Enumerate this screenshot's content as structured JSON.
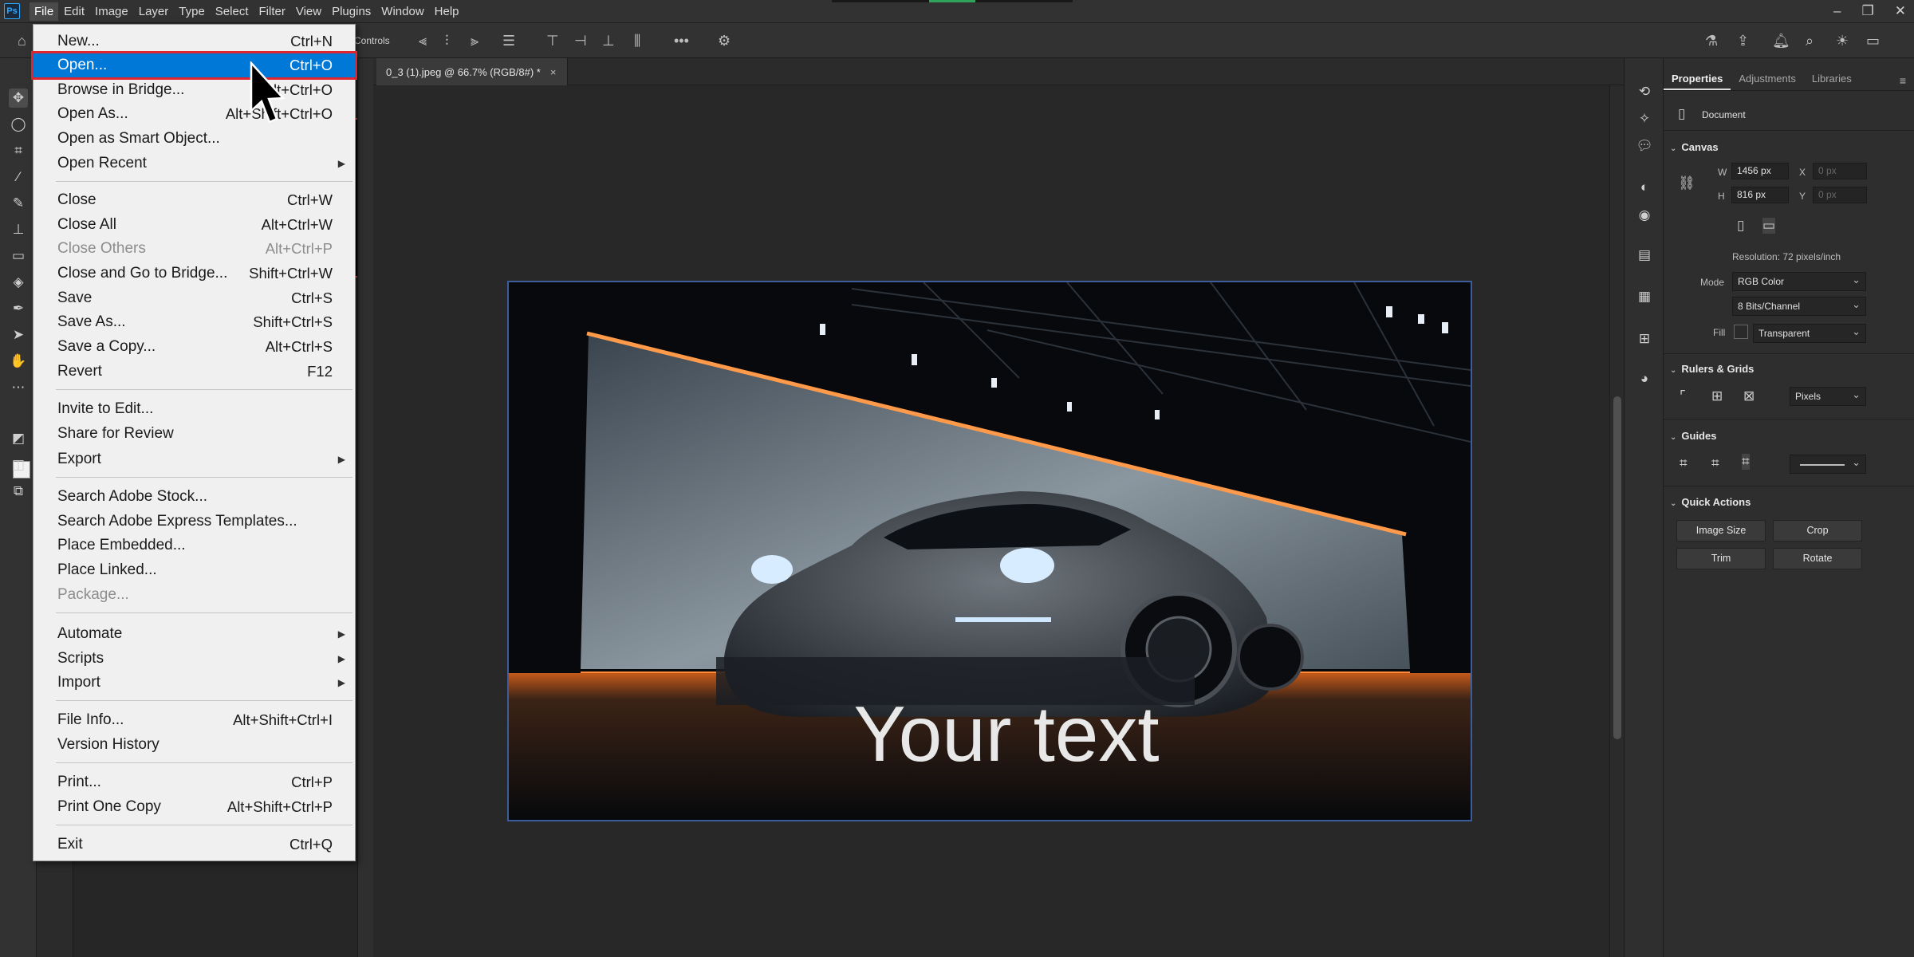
{
  "menubar": {
    "items": [
      "File",
      "Edit",
      "Image",
      "Layer",
      "Type",
      "Select",
      "Filter",
      "View",
      "Plugins",
      "Window",
      "Help"
    ]
  },
  "options": {
    "controls_label": "Controls"
  },
  "document": {
    "tab_title": "0_3 (1).jpeg @ 66.7% (RGB/8#) *",
    "overlay_text": "Your text"
  },
  "file_menu": {
    "items": [
      {
        "label": "New...",
        "shortcut": "Ctrl+N"
      },
      {
        "label": "Open...",
        "shortcut": "Ctrl+O"
      },
      {
        "label": "Browse in Bridge...",
        "shortcut": "Alt+Ctrl+O"
      },
      {
        "label": "Open As...",
        "shortcut": "Alt+Shift+Ctrl+O"
      },
      {
        "label": "Open as Smart Object...",
        "shortcut": ""
      },
      {
        "label": "Open Recent",
        "shortcut": ""
      },
      {
        "label": "Close",
        "shortcut": "Ctrl+W"
      },
      {
        "label": "Close All",
        "shortcut": "Alt+Ctrl+W"
      },
      {
        "label": "Close Others",
        "shortcut": "Alt+Ctrl+P"
      },
      {
        "label": "Close and Go to Bridge...",
        "shortcut": "Shift+Ctrl+W"
      },
      {
        "label": "Save",
        "shortcut": "Ctrl+S"
      },
      {
        "label": "Save As...",
        "shortcut": "Shift+Ctrl+S"
      },
      {
        "label": "Save a Copy...",
        "shortcut": "Alt+Ctrl+S"
      },
      {
        "label": "Revert",
        "shortcut": "F12"
      },
      {
        "label": "Invite to Edit...",
        "shortcut": ""
      },
      {
        "label": "Share for Review",
        "shortcut": ""
      },
      {
        "label": "Export",
        "shortcut": ""
      },
      {
        "label": "Search Adobe Stock...",
        "shortcut": ""
      },
      {
        "label": "Search Adobe Express Templates...",
        "shortcut": ""
      },
      {
        "label": "Place Embedded...",
        "shortcut": ""
      },
      {
        "label": "Place Linked...",
        "shortcut": ""
      },
      {
        "label": "Package...",
        "shortcut": ""
      },
      {
        "label": "Automate",
        "shortcut": ""
      },
      {
        "label": "Scripts",
        "shortcut": ""
      },
      {
        "label": "Import",
        "shortcut": ""
      },
      {
        "label": "File Info...",
        "shortcut": "Alt+Shift+Ctrl+I"
      },
      {
        "label": "Version History",
        "shortcut": ""
      },
      {
        "label": "Print...",
        "shortcut": "Ctrl+P"
      },
      {
        "label": "Print One Copy",
        "shortcut": "Alt+Shift+Ctrl+P"
      },
      {
        "label": "Exit",
        "shortcut": "Ctrl+Q"
      }
    ]
  },
  "properties": {
    "tabs": [
      "Properties",
      "Adjustments",
      "Libraries"
    ],
    "document_label": "Document",
    "canvas_title": "Canvas",
    "w_label": "W",
    "w_value": "1456 px",
    "h_label": "H",
    "h_value": "816 px",
    "x_label": "X",
    "x_value": "0 px",
    "y_label": "Y",
    "y_value": "0 px",
    "resolution": "Resolution: 72 pixels/inch",
    "mode_label": "Mode",
    "mode_value": "RGB Color",
    "depth_value": "8 Bits/Channel",
    "fill_label": "Fill",
    "fill_value": "Transparent",
    "rulers_title": "Rulers & Grids",
    "units_value": "Pixels",
    "guides_title": "Guides",
    "quick_title": "Quick Actions",
    "btn_image_size": "Image Size",
    "btn_crop": "Crop",
    "btn_trim": "Trim",
    "btn_rotate": "Rotate"
  },
  "colors": {
    "highlight": "#0078d7",
    "annotation": "#e0242e",
    "canvas_border": "#3c5c9b"
  }
}
